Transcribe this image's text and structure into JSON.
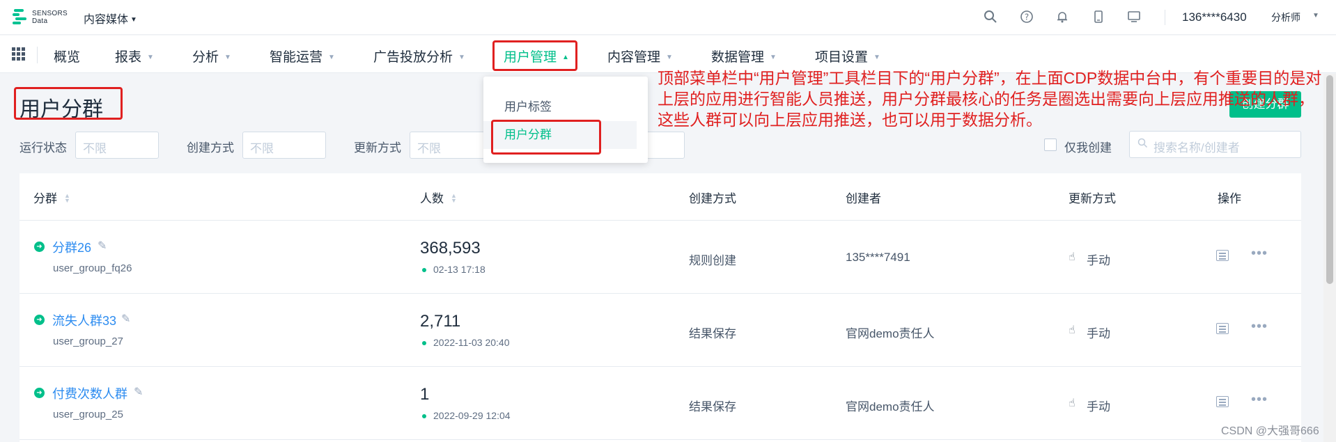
{
  "header": {
    "logo_text_1": "SENSORS",
    "logo_text_2": "Data",
    "project": "内容媒体",
    "user_phone": "136****6430",
    "user_role": "分析师",
    "icons": [
      "search-icon",
      "help-icon",
      "bell-icon",
      "mobile-icon",
      "monitor-icon"
    ]
  },
  "nav": {
    "items": [
      {
        "label": "概览",
        "caret": false
      },
      {
        "label": "报表",
        "caret": true
      },
      {
        "label": "分析",
        "caret": true
      },
      {
        "label": "智能运营",
        "caret": true
      },
      {
        "label": "广告投放分析",
        "caret": true
      },
      {
        "label": "用户管理",
        "caret": true,
        "active": true
      },
      {
        "label": "内容管理",
        "caret": true
      },
      {
        "label": "数据管理",
        "caret": true
      },
      {
        "label": "项目设置",
        "caret": true
      }
    ]
  },
  "dropdown": {
    "items": [
      {
        "label": "用户标签"
      },
      {
        "label": "用户分群",
        "selected": true
      }
    ]
  },
  "page": {
    "title": "用户分群",
    "create_button": "创建分群"
  },
  "filters": {
    "run_status_label": "运行状态",
    "run_status_value": "不限",
    "create_method_label": "创建方式",
    "create_method_value": "不限",
    "update_method_label": "更新方式",
    "update_method_value": "不限",
    "only_mine_label": "仅我创建",
    "search_placeholder": "搜索名称/创建者"
  },
  "table": {
    "columns": {
      "group": "分群",
      "count": "人数",
      "create_method": "创建方式",
      "creator": "创建者",
      "update_method": "更新方式",
      "actions": "操作"
    },
    "rows": [
      {
        "name": "分群26",
        "code": "user_group_fq26",
        "count": "368,593",
        "time": "02-13 17:18",
        "create_method": "规则创建",
        "creator": "135****7491",
        "update_method": "手动"
      },
      {
        "name": "流失人群33",
        "code": "user_group_27",
        "count": "2,711",
        "time": "2022-11-03 20:40",
        "create_method": "结果保存",
        "creator": "官网demo责任人",
        "update_method": "手动"
      },
      {
        "name": "付费次数人群",
        "code": "user_group_25",
        "count": "1",
        "time": "2022-09-29 12:04",
        "create_method": "结果保存",
        "creator": "官网demo责任人",
        "update_method": "手动"
      }
    ]
  },
  "annotation": {
    "text": "顶部菜单栏中“用户管理”工具栏目下的“用户分群”，在上面CDP数据中台中，有个重要目的是对上层的应用进行智能人员推送，用户分群最核心的任务是圈选出需要向上层应用推送的人群，这些人群可以向上层应用推送，也可以用于数据分析。",
    "color": "#e02020"
  },
  "watermark": "CSDN @大强哥666",
  "colors": {
    "accent": "#00bf8a",
    "link": "#2d8cf0",
    "annotation_red": "#e02020"
  }
}
